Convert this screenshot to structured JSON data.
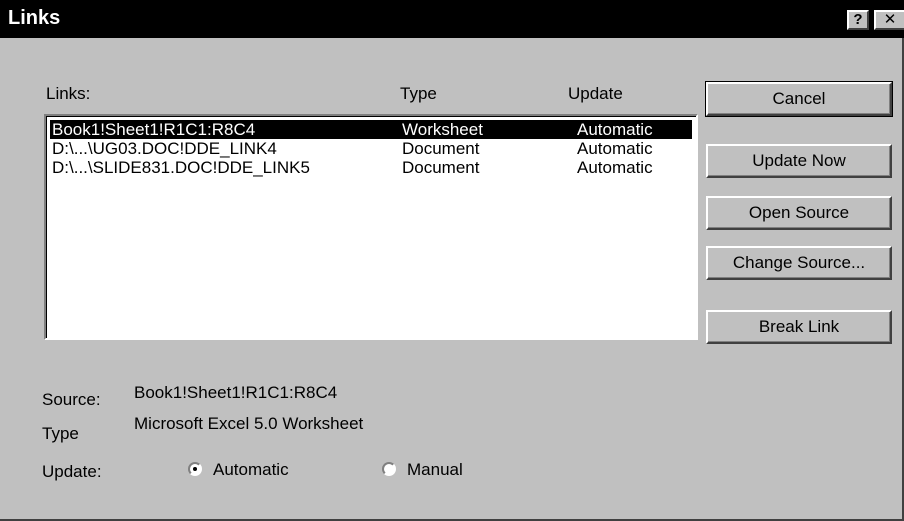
{
  "window": {
    "title": "Links",
    "help_glyph": "?",
    "close_glyph": "✕"
  },
  "list": {
    "label": "Links:",
    "headers": {
      "name": "Links:",
      "type": "Type",
      "update": "Update"
    },
    "rows": [
      {
        "name": "Book1!Sheet1!R1C1:R8C4",
        "type": "Worksheet",
        "update": "Automatic",
        "selected": true
      },
      {
        "name": "D:\\...\\UG03.DOC!DDE_LINK4",
        "type": "Document",
        "update": "Automatic",
        "selected": false
      },
      {
        "name": "D:\\...\\SLIDE831.DOC!DDE_LINK5",
        "type": "Document",
        "update": "Automatic",
        "selected": false
      }
    ]
  },
  "buttons": {
    "cancel": "Cancel",
    "update_now": "Update Now",
    "open_source": "Open Source",
    "change_source": "Change Source...",
    "break_link": "Break Link"
  },
  "details": {
    "source_label": "Source:",
    "source_value": "Book1!Sheet1!R1C1:R8C4",
    "type_label": "Type",
    "type_value": "Microsoft Excel 5.0 Worksheet",
    "update_label": "Update:",
    "automatic_label": "Automatic",
    "manual_label": "Manual",
    "selected_mode": "automatic"
  }
}
